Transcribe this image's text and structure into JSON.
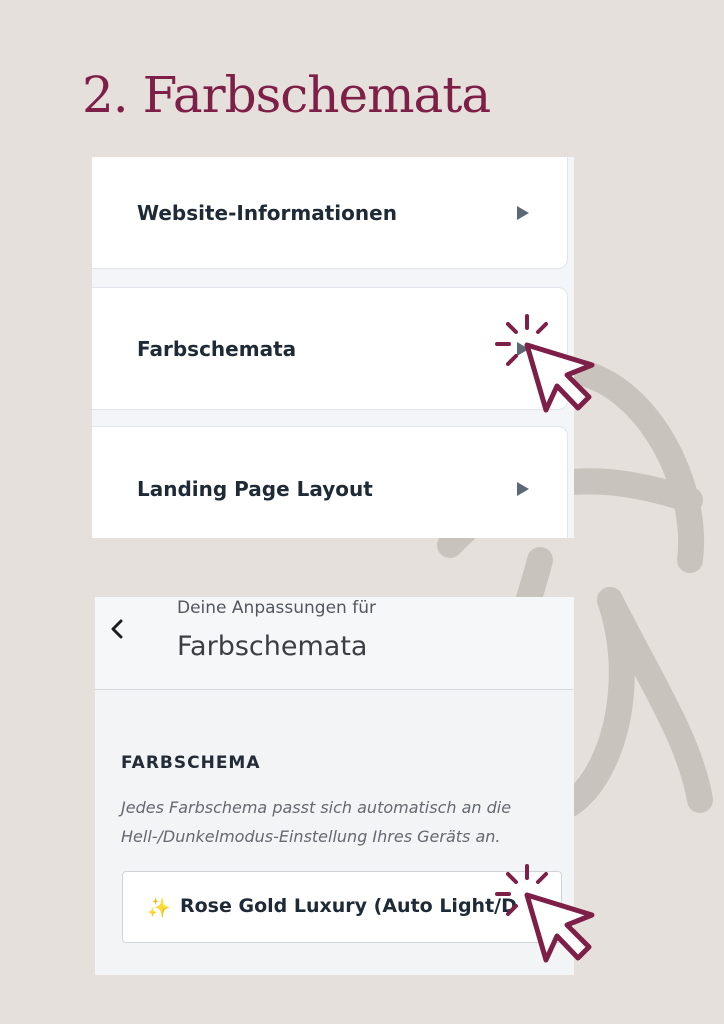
{
  "page": {
    "title": "2. Farbschemata"
  },
  "menu": {
    "items": [
      {
        "label": "Website-Informationen"
      },
      {
        "label": "Farbschemata"
      },
      {
        "label": "Landing Page Layout"
      }
    ]
  },
  "customizer": {
    "subtitle": "Deine Anpassungen für",
    "title": "Farbschemata",
    "section_heading": "FARBSCHEMA",
    "section_description": "Jedes Farbschema passt sich automatisch an die Hell-/Dunkelmodus-Einstellung Ihres Geräts an.",
    "select": {
      "icon": "sparkles-icon",
      "value": "Rose Gold Luxury (Auto Light/D"
    }
  },
  "colors": {
    "accent": "#7d1f47",
    "background": "#e6e0dc"
  }
}
